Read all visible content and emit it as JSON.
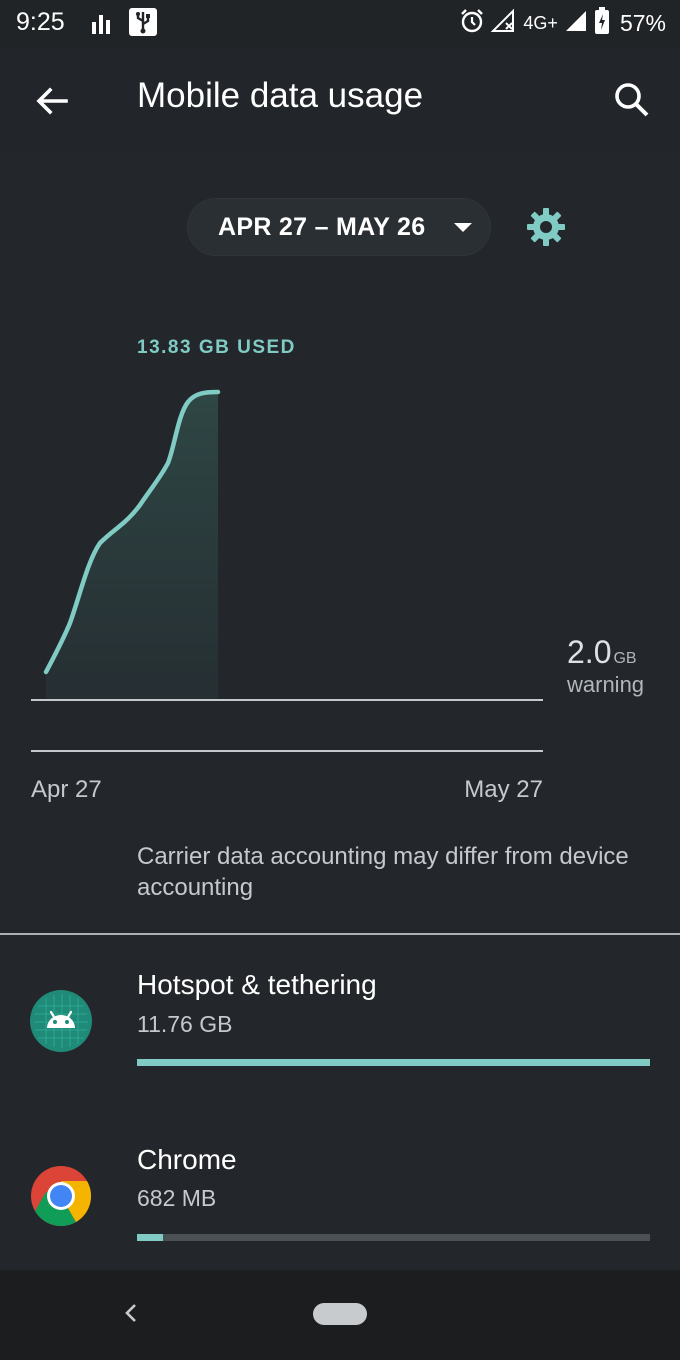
{
  "status_bar": {
    "time": "9:25",
    "network": "4G+",
    "battery": "57%",
    "icons": [
      "signal-bars-icon",
      "usb-icon",
      "alarm-icon",
      "no-signal-icon",
      "cell-signal-icon",
      "battery-charging-icon"
    ]
  },
  "header": {
    "title": "Mobile data usage",
    "back_icon": "back-arrow-icon",
    "search_icon": "search-icon"
  },
  "cycle": {
    "label": "APR 27 – MAY 26",
    "settings_icon": "gear-icon"
  },
  "usage_chart": {
    "used_label": "13.83 GB USED",
    "warning_value": "2.0",
    "warning_unit": "GB",
    "warning_label": "warning",
    "date_start": "Apr 27",
    "date_end": "May 27",
    "accent_color": "#80cbc4"
  },
  "note": "Carrier data accounting may differ from device accounting",
  "apps": [
    {
      "name": "Hotspot & tethering",
      "usage": "11.76 GB",
      "fraction": 1.0,
      "icon": "android-icon"
    },
    {
      "name": "Chrome",
      "usage": "682 MB",
      "fraction": 0.05,
      "icon": "chrome-icon"
    }
  ]
}
